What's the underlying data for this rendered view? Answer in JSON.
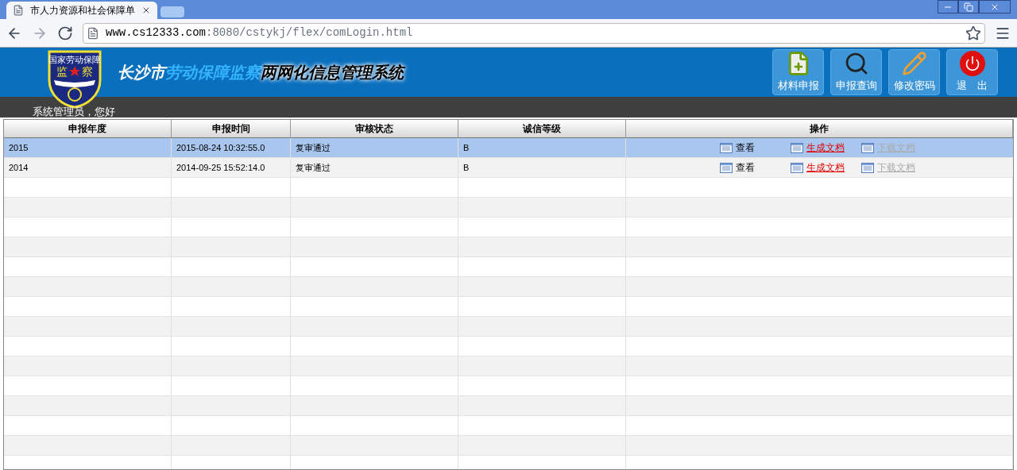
{
  "browser": {
    "tab_title": "市人力资源和社会保障单",
    "url_host": "www.cs12333.com",
    "url_path": ":8080/cstykj/flex/comLogin.html"
  },
  "header": {
    "logo": {
      "top_text": "国家劳动保障",
      "left_char": "监",
      "right_char": "察"
    },
    "title_parts": [
      {
        "text": "长沙市",
        "kind": "light"
      },
      {
        "text": "劳动保障监察",
        "kind": "accent"
      },
      {
        "text": "两网化信息管理系统",
        "kind": "dark"
      }
    ],
    "buttons": [
      {
        "label": "材料申报",
        "kind": "add"
      },
      {
        "label": "申报查询",
        "kind": "search"
      },
      {
        "label": "修改密码",
        "kind": "edit"
      },
      {
        "label": "退　出",
        "kind": "logout"
      }
    ],
    "greeting": "系统管理员，您好"
  },
  "table": {
    "columns": [
      "申报年度",
      "申报时间",
      "审核状态",
      "诚信等级",
      "操作"
    ],
    "rows": [
      {
        "selected": true,
        "cells": [
          "2015",
          "2015-08-24 10:32:55.0",
          "复审通过",
          "B"
        ],
        "actions": [
          {
            "label": "查看",
            "kind": "plain",
            "disabled": false
          },
          {
            "label": "生成文档",
            "kind": "link",
            "disabled": false
          },
          {
            "label": "下载文档",
            "kind": "link",
            "disabled": true
          }
        ]
      },
      {
        "selected": false,
        "cells": [
          "2014",
          "2014-09-25 15:52:14.0",
          "复审通过",
          "B"
        ],
        "actions": [
          {
            "label": "查看",
            "kind": "plain",
            "disabled": false
          },
          {
            "label": "生成文档",
            "kind": "link",
            "disabled": false
          },
          {
            "label": "下载文档",
            "kind": "link",
            "disabled": true
          }
        ]
      }
    ]
  }
}
